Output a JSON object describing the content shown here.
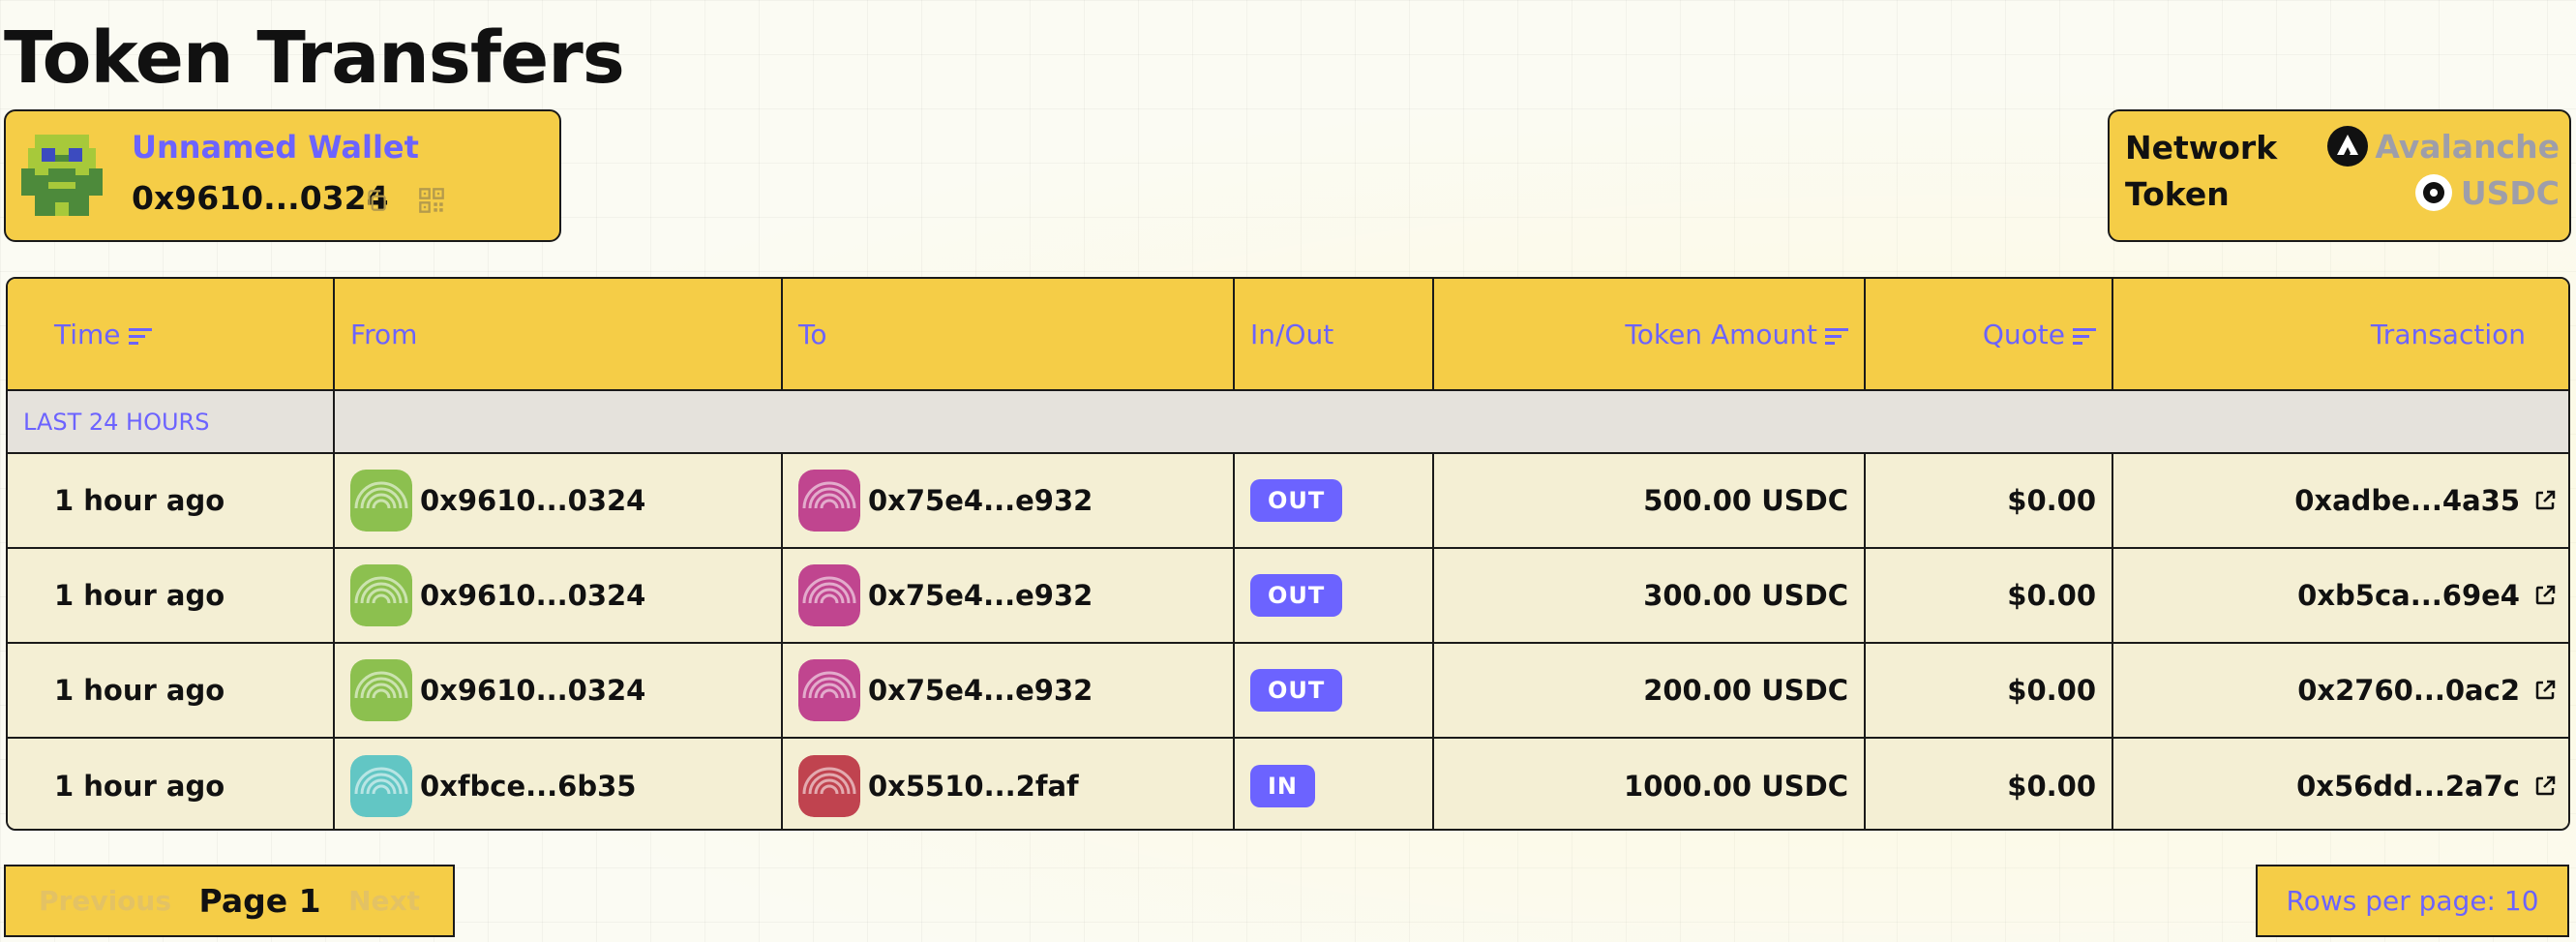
{
  "page": {
    "title": "Token Transfers"
  },
  "wallet": {
    "name": "Unnamed Wallet",
    "address": "0x9610...0324"
  },
  "filters": {
    "network_label": "Network",
    "network_value": "Avalanche",
    "token_label": "Token",
    "token_value": "USDC"
  },
  "table": {
    "columns": [
      "Time",
      "From",
      "To",
      "In/Out",
      "Token Amount",
      "Quote",
      "Transaction"
    ],
    "group_label": "LAST 24 HOURS",
    "rows": [
      {
        "time": "1 hour ago",
        "from": "0x9610...0324",
        "to": "0x75e4...e932",
        "direction": "OUT",
        "amount": "500.00 USDC",
        "quote": "$0.00",
        "tx": "0xadbe...4a35",
        "from_color": "#8cc04f",
        "to_color": "#c0458f"
      },
      {
        "time": "1 hour ago",
        "from": "0x9610...0324",
        "to": "0x75e4...e932",
        "direction": "OUT",
        "amount": "300.00 USDC",
        "quote": "$0.00",
        "tx": "0xb5ca...69e4",
        "from_color": "#8cc04f",
        "to_color": "#c0458f"
      },
      {
        "time": "1 hour ago",
        "from": "0x9610...0324",
        "to": "0x75e4...e932",
        "direction": "OUT",
        "amount": "200.00 USDC",
        "quote": "$0.00",
        "tx": "0x2760...0ac2",
        "from_color": "#8cc04f",
        "to_color": "#c0458f"
      },
      {
        "time": "1 hour ago",
        "from": "0xfbce...6b35",
        "to": "0x5510...2faf",
        "direction": "IN",
        "amount": "1000.00 USDC",
        "quote": "$0.00",
        "tx": "0x56dd...2a7c",
        "from_color": "#62c6c4",
        "to_color": "#c0434f"
      }
    ]
  },
  "pagination": {
    "previous": "Previous",
    "current": "Page 1",
    "next": "Next",
    "rows_per_page": "Rows per page: 10"
  },
  "colors": {
    "accent": "#6c63ff",
    "card": "#f5cd47",
    "border": "#1a1a1a"
  },
  "icons": [
    "wallet-avatar-icon",
    "copy-icon",
    "qr-code-icon",
    "avalanche-icon",
    "usdc-icon",
    "sort-icon",
    "fingerprint-icon",
    "external-link-icon"
  ]
}
